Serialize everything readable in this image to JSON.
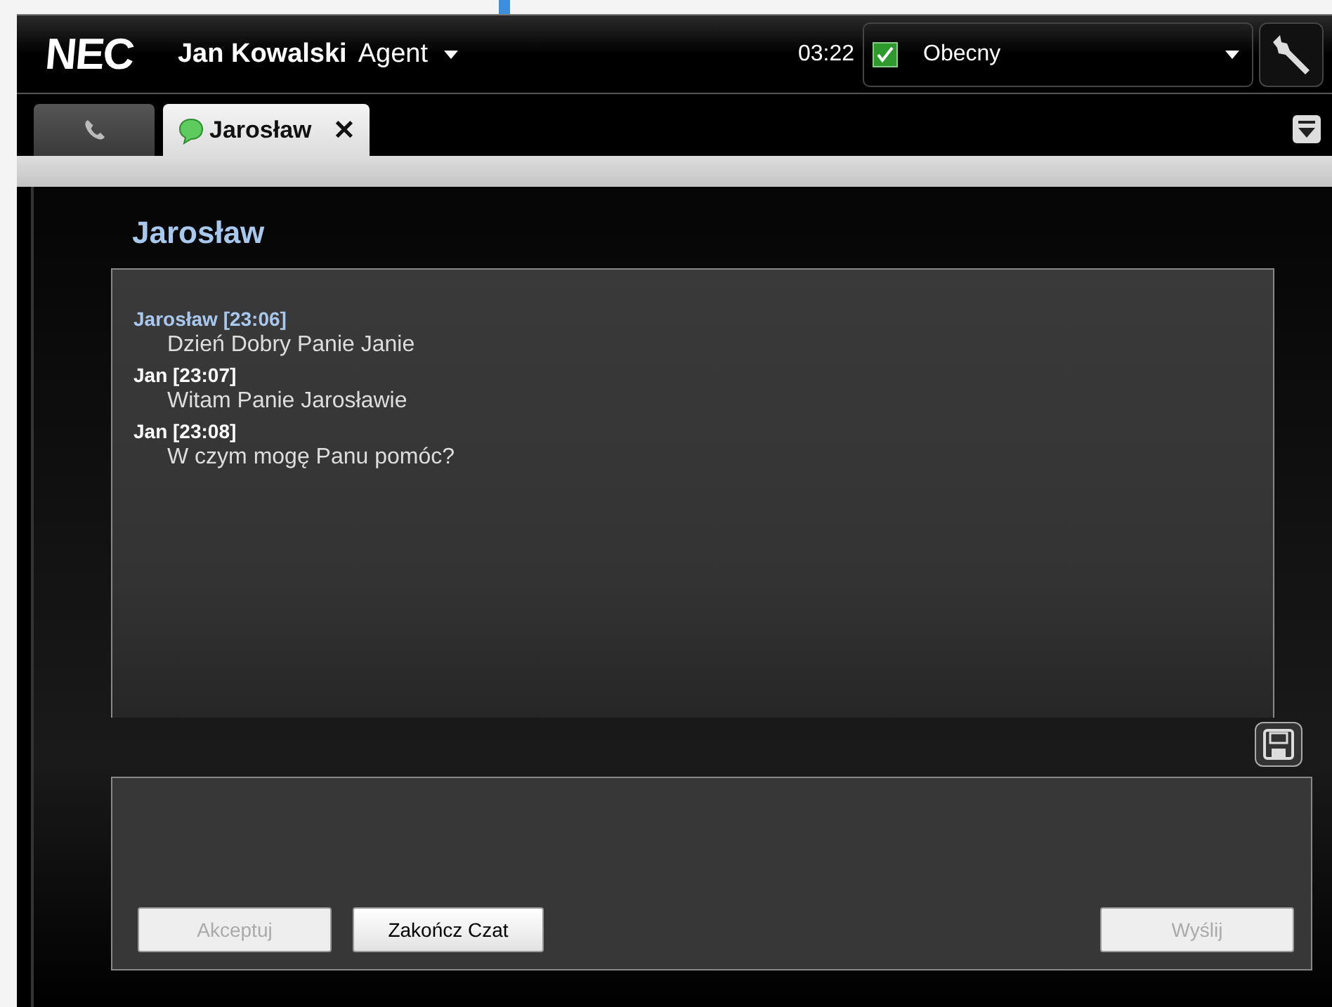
{
  "header": {
    "logo": "NEC",
    "user_name": "Jan Kowalski",
    "role": "Agent",
    "time": "03:22",
    "status": {
      "label": "Obecny",
      "checked": true
    }
  },
  "tabs": [
    {
      "kind": "phone",
      "selected": false
    },
    {
      "kind": "chat",
      "label": "Jarosław",
      "close": "✕",
      "selected": true
    }
  ],
  "chat": {
    "title": "Jarosław",
    "messages": [
      {
        "kind": "remote",
        "sender": "Jarosław [23:06]",
        "text": "Dzień Dobry Panie Janie"
      },
      {
        "kind": "local",
        "sender": "Jan [23:07]",
        "text": "Witam Panie Jarosławie"
      },
      {
        "kind": "local",
        "sender": "Jan [23:08]",
        "text": "W czym mogę Panu pomóc?"
      }
    ]
  },
  "buttons": [
    {
      "label": "Akceptuj",
      "disabled": true
    },
    {
      "label": "Zakończ Czat",
      "disabled": false
    },
    {
      "label": "Wyślij",
      "disabled": true
    }
  ]
}
